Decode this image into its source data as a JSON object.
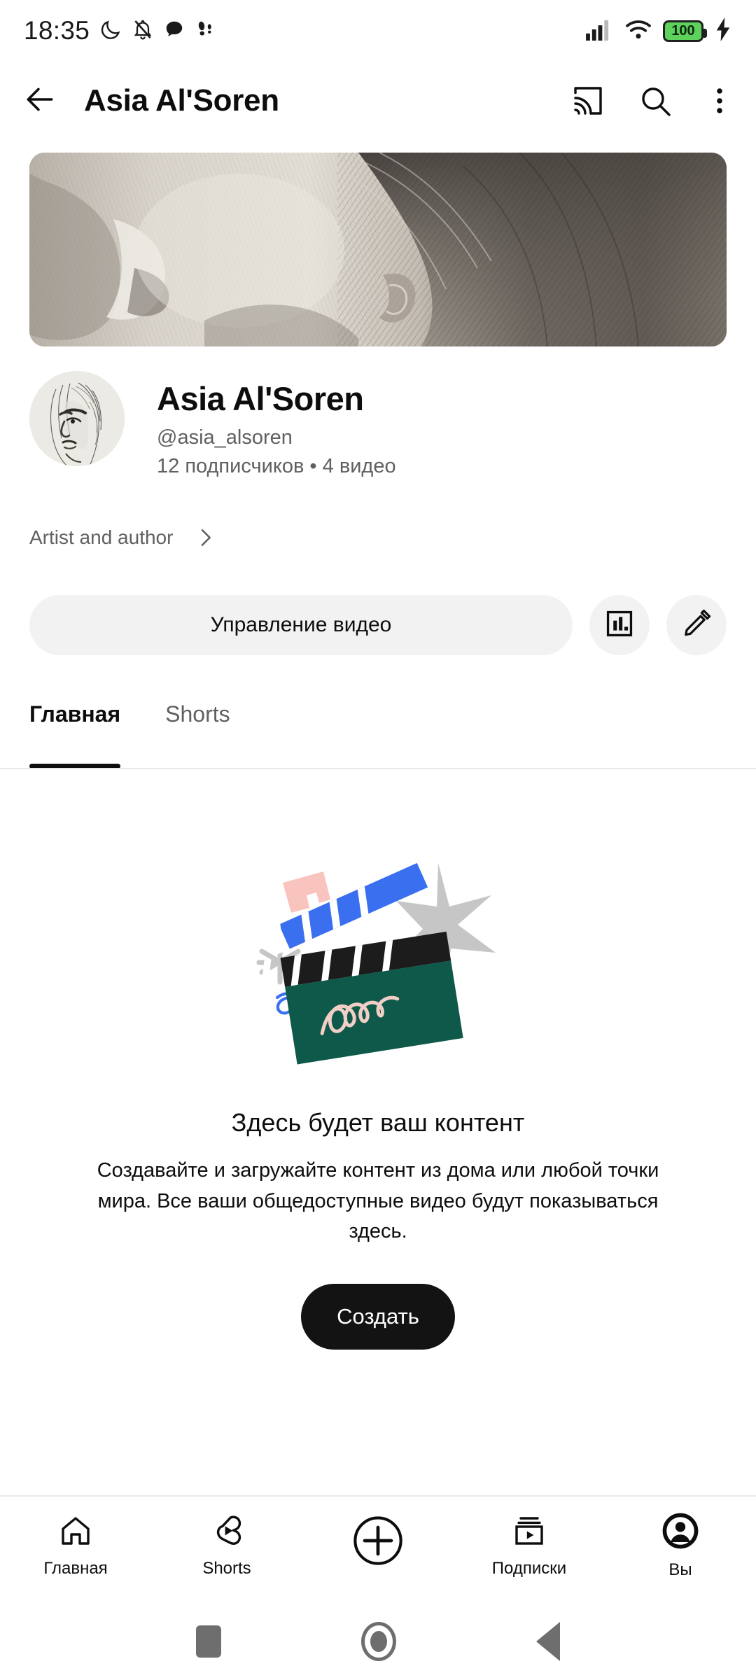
{
  "statusbar": {
    "time": "18:35",
    "icons_left": [
      "moon-dnd-icon",
      "bell-muted-icon",
      "chat-bubble-icon",
      "footsteps-icon"
    ],
    "icons_right": [
      "signal-bars-icon",
      "wifi-icon",
      "battery-icon",
      "charging-bolt-icon"
    ],
    "battery_level": "100",
    "battery_color": "#5DD25D"
  },
  "appbar": {
    "back_icon": "back-arrow-icon",
    "title": "Asia Al'Soren",
    "cast_icon": "cast-icon",
    "search_icon": "search-icon",
    "overflow_icon": "more-vertical-icon"
  },
  "banner": {
    "alt": "pencil-sketch-portrait-banner"
  },
  "channel": {
    "avatar_alt": "pencil-sketch-portrait-avatar",
    "name": "Asia Al'Soren",
    "handle": "@asia_alsoren",
    "stats": "12 подписчиков • 4 видео",
    "description": "Artist and author",
    "description_chevron": "chevron-right-icon"
  },
  "actions": {
    "manage_label": "Управление видео",
    "analytics_icon": "analytics-bar-chart-icon",
    "edit_icon": "pencil-edit-icon"
  },
  "tabs": [
    {
      "label": "Главная",
      "active": true
    },
    {
      "label": "Shorts",
      "active": false
    }
  ],
  "empty_state": {
    "illustration": "clapperboard-illustration",
    "title": "Здесь будет ваш контент",
    "subtitle": "Создавайте и загружайте контент из дома или любой точки мира. Все ваши общедоступные видео будут показываться здесь.",
    "button_label": "Создать"
  },
  "bottom_nav": [
    {
      "label": "Главная",
      "icon": "home-icon",
      "active": false
    },
    {
      "label": "Shorts",
      "icon": "shorts-icon",
      "active": false
    },
    {
      "label": "",
      "icon": "create-plus-icon",
      "active": false
    },
    {
      "label": "Подписки",
      "icon": "subscriptions-icon",
      "active": false
    },
    {
      "label": "Вы",
      "icon": "account-avatar-icon",
      "active": true
    }
  ],
  "system_nav": {
    "recents_icon": "recents-square-icon",
    "home_icon": "home-circle-icon",
    "back_icon": "back-triangle-icon"
  },
  "colors": {
    "accent_blue": "#3A6FF0",
    "clapper_green": "#0E5949",
    "pink": "#F9C4BE",
    "gray": "#C6C6C6",
    "black": "#131313",
    "muted_text": "#606060",
    "chip_bg": "#F2F2F2"
  }
}
